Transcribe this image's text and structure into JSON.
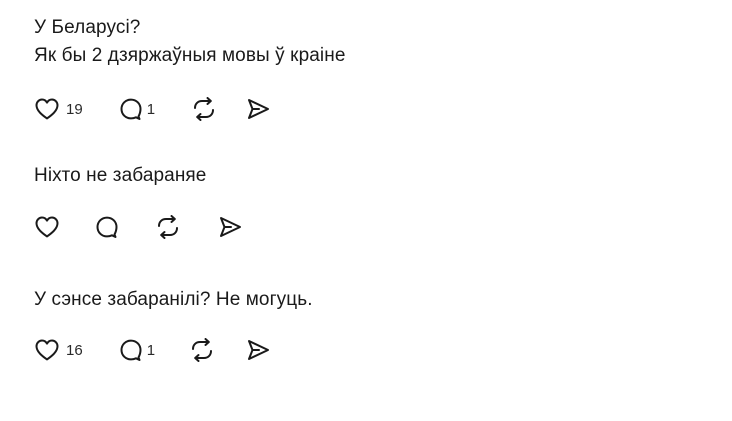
{
  "posts": [
    {
      "text": "У Беларусі?\nЯк бы 2 дзяржаўныя мовы ў краіне",
      "likes": "19",
      "replies": "1"
    },
    {
      "text": "Ніхто не забараняе",
      "likes": "",
      "replies": ""
    },
    {
      "text": "У сэнсе забаранілі? Не могуць.",
      "likes": "16",
      "replies": "1"
    }
  ],
  "icons": {
    "like": "heart-icon",
    "reply": "speech-bubble-icon",
    "repost": "repost-icon",
    "share": "send-icon"
  }
}
